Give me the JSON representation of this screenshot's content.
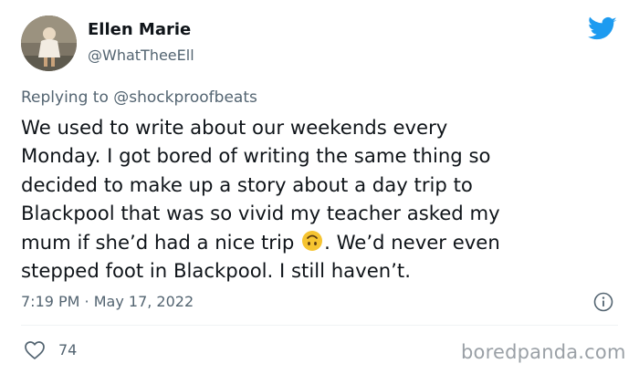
{
  "author": {
    "name": "Ellen Marie",
    "handle": "@WhatTheeEll"
  },
  "reply_context": {
    "prefix": "Replying to",
    "mention": "@shockproofbeats"
  },
  "tweet": {
    "lines": [
      "We used to write about our weekends every",
      "Monday. I got bored of writing the same thing so",
      "decided to make up a story about a day trip to",
      "Blackpool that was so vivid my teacher asked my",
      "mum if she’d had a nice trip",
      ". We’d never even",
      "stepped foot in Blackpool. I still haven’t."
    ],
    "emoji": "upside-down-face"
  },
  "meta": {
    "timestamp": "7:19 PM · May 17, 2022"
  },
  "engagement": {
    "likes": "74"
  },
  "watermark": "boredpanda.com",
  "colors": {
    "twitter_blue": "#1d9bf0",
    "secondary_text": "#536471",
    "watermark": "#9aa0a6",
    "emoji_yellow": "#f6c431"
  },
  "icons": [
    "twitter-bird-icon",
    "info-icon",
    "heart-icon",
    "upside-down-face-emoji"
  ]
}
